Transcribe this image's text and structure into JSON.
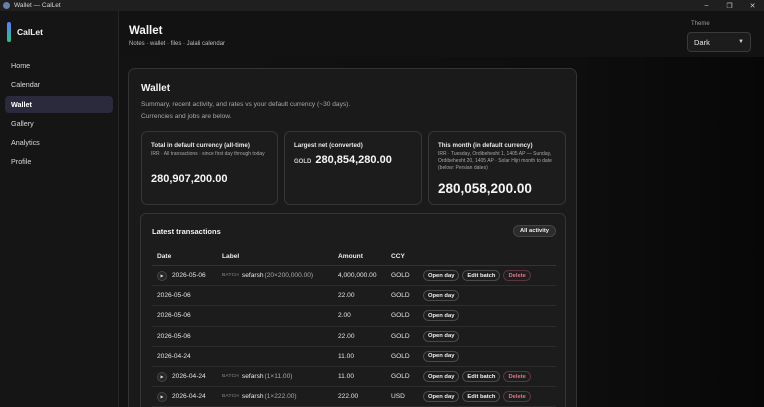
{
  "window": {
    "title": "Wallet — CalLet"
  },
  "brand": {
    "name": "CalLet",
    "accent": "#5a7cff"
  },
  "nav": [
    {
      "label": "Home",
      "active": false
    },
    {
      "label": "Calendar",
      "active": false
    },
    {
      "label": "Wallet",
      "active": true
    },
    {
      "label": "Gallery",
      "active": false
    },
    {
      "label": "Analytics",
      "active": false
    },
    {
      "label": "Profile",
      "active": false
    }
  ],
  "header": {
    "title": "Wallet",
    "subtitle": "Notes · wallet · files · Jalali calendar",
    "theme_label": "Theme",
    "theme_value": "Dark"
  },
  "wallet": {
    "title": "Wallet",
    "description": "Summary, recent activity, and rates vs your default currency (~30 days). Currencies and jobs are below."
  },
  "stats": [
    {
      "label": "Total in default currency (all-time)",
      "meta": "IRR · All transactions · since first day through today",
      "code": "",
      "value": "280,907,200.00"
    },
    {
      "label": "Largest net (converted)",
      "meta": "",
      "code": "GOLD",
      "value": "280,854,280.00"
    },
    {
      "label": "This month (in default currency)",
      "meta": "IRR · Tuesday, Ordibehesht 1, 1405 AP — Sunday, Ordibehesht 20, 1405 AP · Solar Hijri month to date (below: Persian dates)",
      "code": "",
      "value": "280,058,200.00"
    }
  ],
  "transactions": {
    "title": "Latest transactions",
    "all_activity_label": "All activity",
    "columns": {
      "date": "Date",
      "label": "Label",
      "amount": "Amount",
      "ccy": "CCY"
    },
    "batch_tag": "BATCH",
    "actions": {
      "open_day": "Open day",
      "edit_batch": "Edit batch",
      "delete": "Delete"
    },
    "rows": [
      {
        "expandable": true,
        "date": "2026-05-06",
        "batch_name": "sefarsh",
        "batch_detail": "(20×200,000.00)",
        "amount": "4,000,000.00",
        "ccy": "GOLD"
      },
      {
        "expandable": false,
        "date": "2026-05-06",
        "batch_name": "",
        "batch_detail": "",
        "amount": "22.00",
        "ccy": "GOLD"
      },
      {
        "expandable": false,
        "date": "2026-05-06",
        "batch_name": "",
        "batch_detail": "",
        "amount": "2.00",
        "ccy": "GOLD"
      },
      {
        "expandable": false,
        "date": "2026-05-06",
        "batch_name": "",
        "batch_detail": "",
        "amount": "22.00",
        "ccy": "GOLD"
      },
      {
        "expandable": false,
        "date": "2026-04-24",
        "batch_name": "",
        "batch_detail": "",
        "amount": "11.00",
        "ccy": "GOLD"
      },
      {
        "expandable": true,
        "date": "2026-04-24",
        "batch_name": "sefarsh",
        "batch_detail": "(1×11.00)",
        "amount": "11.00",
        "ccy": "GOLD"
      },
      {
        "expandable": true,
        "date": "2026-04-24",
        "batch_name": "sefarsh",
        "batch_detail": "(1×222.00)",
        "amount": "222.00",
        "ccy": "USD"
      }
    ]
  }
}
